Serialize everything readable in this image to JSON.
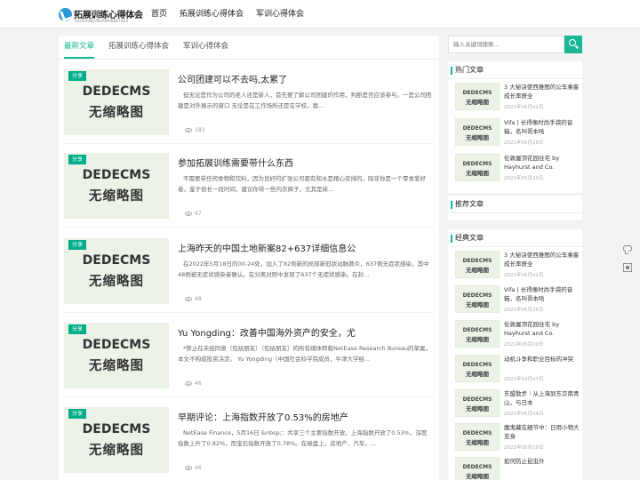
{
  "site": {
    "logo_text": "拓展训练心得体会",
    "logo_sub": "TUOZHANXUNLIANXINDETIHUI"
  },
  "nav": [
    "首页",
    "拓展训练心得体会",
    "军训心得体会"
  ],
  "tabs": [
    "最新文章",
    "拓展训练心得体会",
    "军训心得体会"
  ],
  "placeholder": {
    "line1": "DEDECMS",
    "line2": "无缩略图"
  },
  "articles": [
    {
      "badge": "分享",
      "title": "公司团建可以不去吗,太累了",
      "desc": "但无论是作为公司的老人还是新人，首先要了解公司团建的作用，判断是否应该参与。一是公司团建是对外展示的窗口 无论是在工作场所还是在学校，我...",
      "views": "183"
    },
    {
      "badge": "分享",
      "title": "参加拓展训练需要带什么东西",
      "desc": "不需要带任何食物和饮料，因为良好的扩张公司都有和水是精心安排的，除非你是一个零食爱好者，鉴于很长一段时间，建议你带一些内衣裤子，尤其是袜...",
      "views": "47"
    },
    {
      "badge": "分享",
      "title": "上海昨天的中国土地新案82+637详细信息公",
      "desc": "在2022年5月18日的00-24处，加入了82例新的局部新冠状动脉肺炎，637例无症状感染，其中48例被无症状感染者确认。在分离对照中发现了637个无症状感染。在封...",
      "views": "48"
    },
    {
      "badge": "分享",
      "title": "Yu Yongding：改善中国海外资产的安全，尤",
      "desc": "*禁止在未经同意（包括朋友）（包括朋友）的所有媒体转载NetEase Research Bureau的草案。本文不构成投资决定。 Yu Yongding（中国社会科学院成员，牛津大学经...",
      "views": "46"
    },
    {
      "badge": "分享",
      "title": "早期评论：上海指数开放了0.53%的房地产",
      "desc": "NetEase Finance，5月16日 &nbsp;：共享三个主要指数开放。上海指数开放了0.53%，深度指数上升了0.82%，而宝石指数开放了0.78%。在磁盘上，房地产，汽车，...",
      "views": "46"
    }
  ],
  "search": {
    "placeholder": "输入关键词搜索..."
  },
  "hot": {
    "title": "热门文章",
    "items": [
      {
        "title": "3 大秘诀使西雅图的公车乘客成长率居全",
        "date": "2021年05月02日"
      },
      {
        "title": "Vifa | 长得像时尚手袋的音箱，名叫哥本哈",
        "date": "2021年05月26日"
      },
      {
        "title": "伦敦屡顶花园住宅 by Hayhurst and Co.",
        "date": "2021年05月20日"
      }
    ]
  },
  "recommend": {
    "title": "推荐文章"
  },
  "classic": {
    "title": "经典文章",
    "items": [
      {
        "title": "3 大秘诀使西雅图的公车乘客成长率居全",
        "date": "2021年05月02日"
      },
      {
        "title": "Vifa | 长得像时尚手袋的音箱，名叫哥本哈",
        "date": "2021年05月26日"
      },
      {
        "title": "伦敦屡顶花园住宅 by Hayhurst and Co.",
        "date": "2021年05月20日"
      },
      {
        "title": "动机斗争和职业目标的冲突",
        "date": "2021年03月07日"
      },
      {
        "title": "东盟散步｜从上海到东京南青山，与日本",
        "date": "2021年05月04日"
      },
      {
        "title": "魔鬼藏在细节中：日用小物大变身",
        "date": "2021年05月19日"
      },
      {
        "title": "如何防止昆虫外",
        "date": ""
      }
    ]
  }
}
